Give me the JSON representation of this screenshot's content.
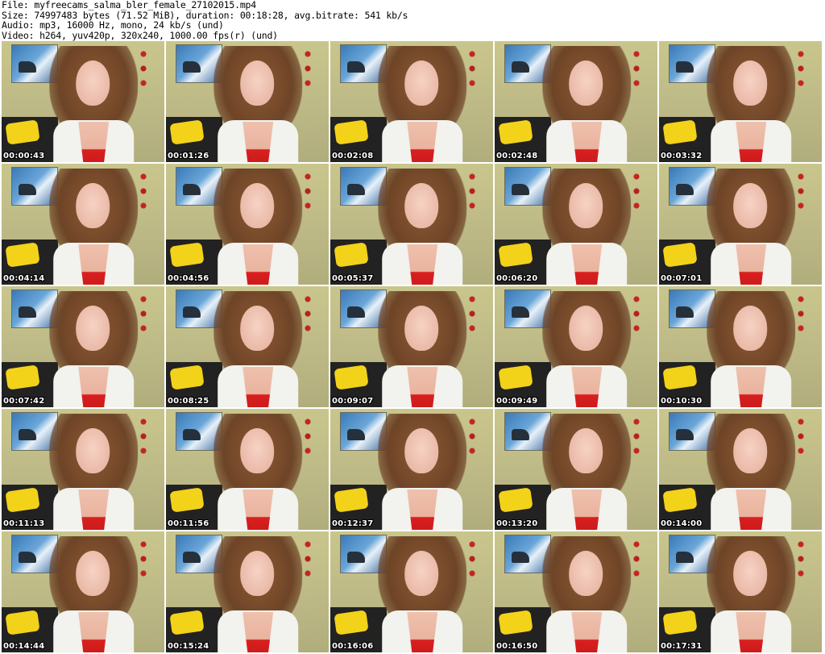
{
  "header": {
    "file": "File: myfreecams_salma_bler_female_27102015.mp4",
    "size": "Size: 74997483 bytes (71.52 MiB), duration: 00:18:28, avg.bitrate: 541 kb/s",
    "audio": "Audio: mp3, 16000 Hz, mono, 24 kb/s (und)",
    "video": "Video: h264, yuv420p, 320x240, 1000.00 fps(r) (und)"
  },
  "thumbnails": [
    {
      "timestamp": "00:00:43"
    },
    {
      "timestamp": "00:01:26"
    },
    {
      "timestamp": "00:02:08"
    },
    {
      "timestamp": "00:02:48"
    },
    {
      "timestamp": "00:03:32"
    },
    {
      "timestamp": "00:04:14"
    },
    {
      "timestamp": "00:04:56"
    },
    {
      "timestamp": "00:05:37"
    },
    {
      "timestamp": "00:06:20"
    },
    {
      "timestamp": "00:07:01"
    },
    {
      "timestamp": "00:07:42"
    },
    {
      "timestamp": "00:08:25"
    },
    {
      "timestamp": "00:09:07"
    },
    {
      "timestamp": "00:09:49"
    },
    {
      "timestamp": "00:10:30"
    },
    {
      "timestamp": "00:11:13"
    },
    {
      "timestamp": "00:11:56"
    },
    {
      "timestamp": "00:12:37"
    },
    {
      "timestamp": "00:13:20"
    },
    {
      "timestamp": "00:14:00"
    },
    {
      "timestamp": "00:14:44"
    },
    {
      "timestamp": "00:15:24"
    },
    {
      "timestamp": "00:16:06"
    },
    {
      "timestamp": "00:16:50"
    },
    {
      "timestamp": "00:17:31"
    }
  ]
}
